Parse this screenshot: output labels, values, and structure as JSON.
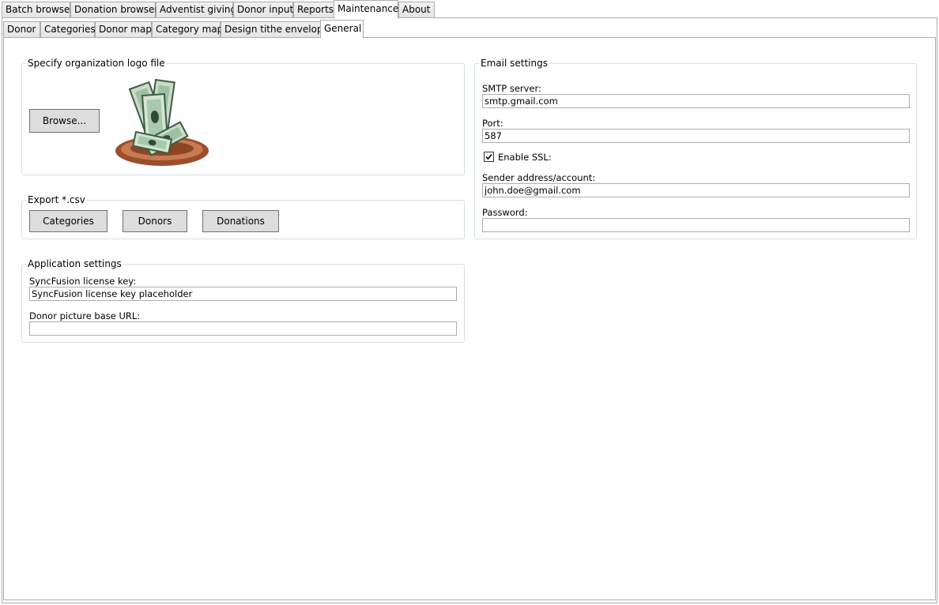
{
  "main_tabs": [
    {
      "label": "Batch browser",
      "selected": false
    },
    {
      "label": "Donation browser",
      "selected": false
    },
    {
      "label": "Adventist giving",
      "selected": false
    },
    {
      "label": "Donor input",
      "selected": false
    },
    {
      "label": "Reports",
      "selected": false
    },
    {
      "label": "Maintenance",
      "selected": true
    },
    {
      "label": "About",
      "selected": false
    }
  ],
  "sub_tabs": [
    {
      "label": "Donor",
      "selected": false
    },
    {
      "label": "Categories",
      "selected": false
    },
    {
      "label": "Donor map",
      "selected": false
    },
    {
      "label": "Category map",
      "selected": false
    },
    {
      "label": "Design tithe envelope",
      "selected": false
    },
    {
      "label": "General",
      "selected": true
    }
  ],
  "logo_group": {
    "title": "Specify organization logo file",
    "browse_label": "Browse...",
    "logo_icon": "money-offering-plate-icon"
  },
  "export_group": {
    "title": "Export *.csv",
    "buttons": [
      "Categories",
      "Donors",
      "Donations"
    ]
  },
  "app_settings": {
    "title": "Application settings",
    "license_label": "SyncFusion license key:",
    "license_value": "SyncFusion license key placeholder",
    "picture_url_label": "Donor picture base URL:",
    "picture_url_value": ""
  },
  "email_settings": {
    "title": "Email settings",
    "smtp_label": "SMTP server:",
    "smtp_value": "smtp.gmail.com",
    "port_label": "Port:",
    "port_value": "587",
    "ssl_label": "Enable SSL:",
    "ssl_checked": true,
    "sender_label": "Sender address/account:",
    "sender_value": "john.doe@gmail.com",
    "password_label": "Password:",
    "password_value": ""
  }
}
